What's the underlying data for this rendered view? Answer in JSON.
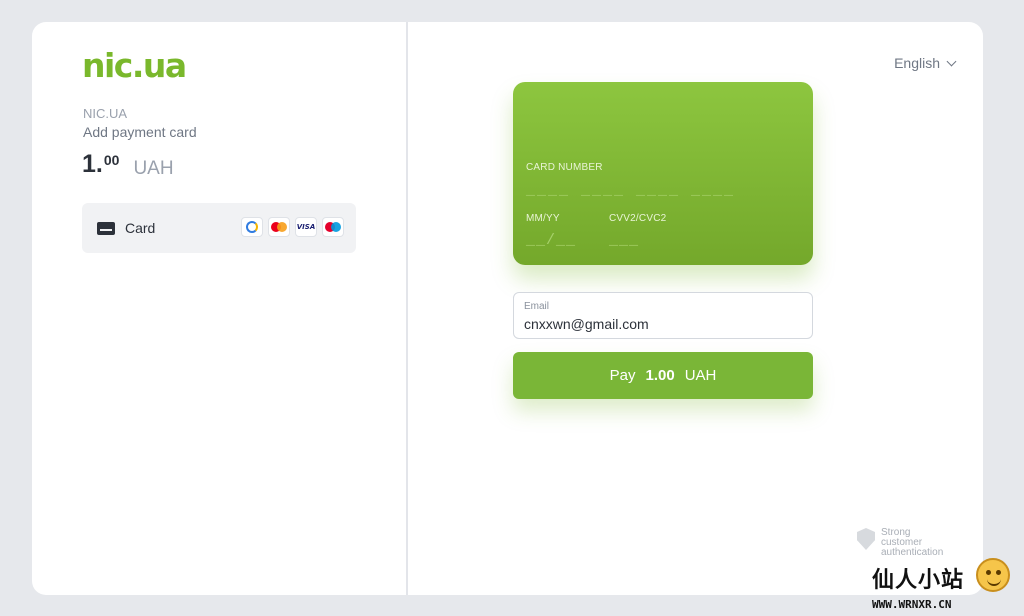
{
  "brand": {
    "logo_main": "nic",
    "logo_dot": ".",
    "logo_tld": "ua"
  },
  "order": {
    "merchant": "NIC.UA",
    "description": "Add payment card",
    "amount_integer": "1.",
    "amount_decimal": "00",
    "currency": "UAH"
  },
  "payment_method": {
    "label": "Card",
    "icon": "card-icon",
    "brands": [
      "google-pay-icon",
      "mastercard-icon",
      "visa-icon",
      "maestro-icon"
    ],
    "visa_text": "VISA"
  },
  "language": {
    "selected": "English",
    "icon": "chevron-down-icon"
  },
  "card_form": {
    "number_label": "CARD NUMBER",
    "number_placeholder": "____ ____ ____ ____",
    "expiry_label": "MM/YY",
    "expiry_placeholder": "__/__",
    "cvv_label": "CVV2/CVC2",
    "cvv_placeholder": "___"
  },
  "email": {
    "label": "Email",
    "value": "cnxxwn@gmail.com"
  },
  "pay_button": {
    "prefix": "Pay",
    "amount": "1.00",
    "currency": "UAH"
  },
  "secure_badge": {
    "text": "Strong customer authentication",
    "icon": "shield-icon"
  },
  "watermark": {
    "title": "仙人小站",
    "url": "WWW.WRNXR.CN",
    "icon": "smiley-icon"
  },
  "colors": {
    "accent": "#7ab637",
    "card_top": "#8dc63f",
    "card_bottom": "#74a82b",
    "background": "#e6e8ec"
  }
}
